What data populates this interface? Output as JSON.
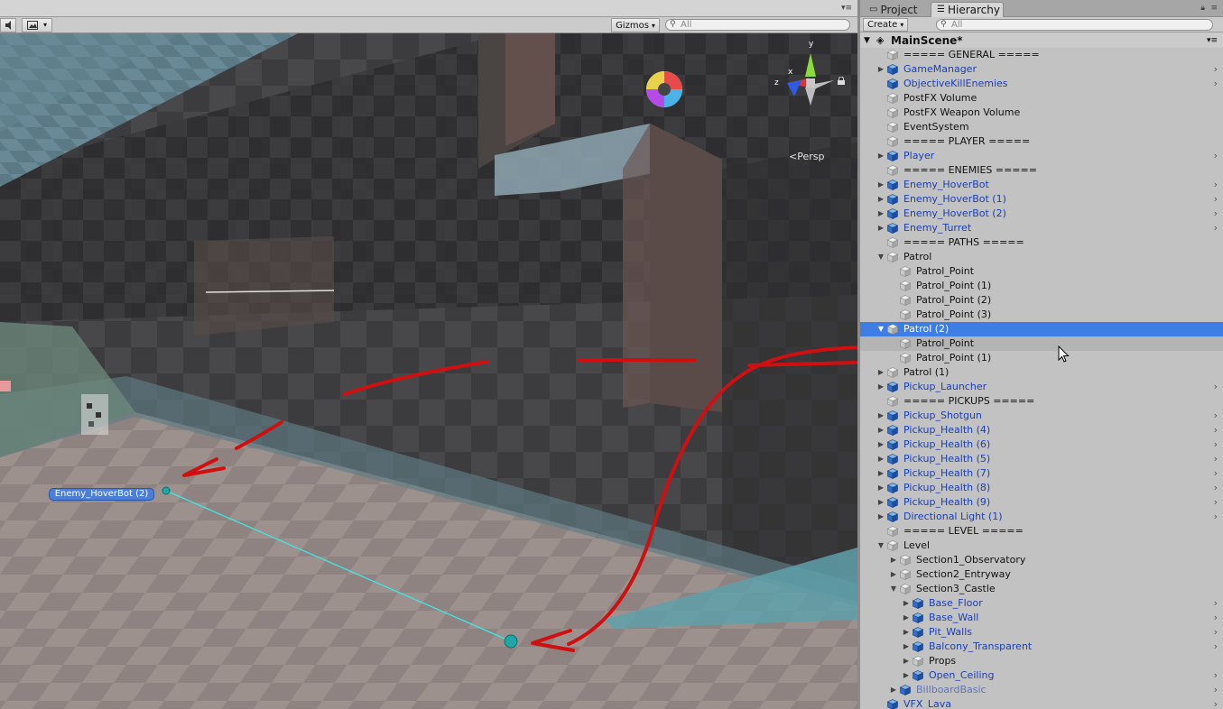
{
  "scene": {
    "gizmos_label": "Gizmos",
    "search_placeholder": "All",
    "persp_label": "<Persp",
    "axis_y": "y",
    "axis_x": "x",
    "axis_z": "z",
    "hoverbot_label": "Enemy_HoverBot (2)"
  },
  "hierarchy": {
    "tab_project": "Project",
    "tab_hierarchy": "Hierarchy",
    "create_label": "Create",
    "search_placeholder": "All",
    "scene_name": "MainScene*",
    "rows": [
      {
        "label": "===== GENERAL =====",
        "indent": 0,
        "arrow": "",
        "icon": "gray",
        "style": "normal",
        "chevron": false
      },
      {
        "label": "GameManager",
        "indent": 0,
        "arrow": "collapsed",
        "icon": "blue",
        "style": "prefab",
        "chevron": true
      },
      {
        "label": "ObjectiveKillEnemies",
        "indent": 0,
        "arrow": "",
        "icon": "blue",
        "style": "prefab",
        "chevron": true
      },
      {
        "label": "PostFX Volume",
        "indent": 0,
        "arrow": "",
        "icon": "gray",
        "style": "normal",
        "chevron": false
      },
      {
        "label": "PostFX Weapon Volume",
        "indent": 0,
        "arrow": "",
        "icon": "gray",
        "style": "normal",
        "chevron": false
      },
      {
        "label": "EventSystem",
        "indent": 0,
        "arrow": "",
        "icon": "gray",
        "style": "normal",
        "chevron": false
      },
      {
        "label": "===== PLAYER =====",
        "indent": 0,
        "arrow": "",
        "icon": "gray",
        "style": "normal",
        "chevron": false
      },
      {
        "label": "Player",
        "indent": 0,
        "arrow": "collapsed",
        "icon": "blue",
        "style": "prefab",
        "chevron": true
      },
      {
        "label": "===== ENEMIES =====",
        "indent": 0,
        "arrow": "",
        "icon": "gray",
        "style": "normal",
        "chevron": false
      },
      {
        "label": "Enemy_HoverBot",
        "indent": 0,
        "arrow": "collapsed",
        "icon": "blue",
        "style": "prefab",
        "chevron": true
      },
      {
        "label": "Enemy_HoverBot (1)",
        "indent": 0,
        "arrow": "collapsed",
        "icon": "blue",
        "style": "prefab",
        "chevron": true
      },
      {
        "label": "Enemy_HoverBot (2)",
        "indent": 0,
        "arrow": "collapsed",
        "icon": "blue",
        "style": "prefab",
        "chevron": true
      },
      {
        "label": "Enemy_Turret",
        "indent": 0,
        "arrow": "collapsed",
        "icon": "blue",
        "style": "prefab",
        "chevron": true
      },
      {
        "label": "===== PATHS =====",
        "indent": 0,
        "arrow": "",
        "icon": "gray",
        "style": "normal",
        "chevron": false
      },
      {
        "label": "Patrol",
        "indent": 0,
        "arrow": "expanded",
        "icon": "gray",
        "style": "normal",
        "chevron": false
      },
      {
        "label": "Patrol_Point",
        "indent": 1,
        "arrow": "",
        "icon": "gray",
        "style": "normal",
        "chevron": false
      },
      {
        "label": "Patrol_Point (1)",
        "indent": 1,
        "arrow": "",
        "icon": "gray",
        "style": "normal",
        "chevron": false
      },
      {
        "label": "Patrol_Point (2)",
        "indent": 1,
        "arrow": "",
        "icon": "gray",
        "style": "normal",
        "chevron": false
      },
      {
        "label": "Patrol_Point (3)",
        "indent": 1,
        "arrow": "",
        "icon": "gray",
        "style": "normal",
        "chevron": false
      },
      {
        "label": "Patrol (2)",
        "indent": 0,
        "arrow": "expanded",
        "icon": "gray",
        "style": "selected",
        "chevron": false
      },
      {
        "label": "Patrol_Point",
        "indent": 1,
        "arrow": "",
        "icon": "gray",
        "style": "hover",
        "chevron": false
      },
      {
        "label": "Patrol_Point (1)",
        "indent": 1,
        "arrow": "",
        "icon": "gray",
        "style": "normal",
        "chevron": false
      },
      {
        "label": "Patrol (1)",
        "indent": 0,
        "arrow": "collapsed",
        "icon": "gray",
        "style": "normal",
        "chevron": false
      },
      {
        "label": "Pickup_Launcher",
        "indent": 0,
        "arrow": "collapsed",
        "icon": "blue",
        "style": "prefab",
        "chevron": true
      },
      {
        "label": "===== PICKUPS =====",
        "indent": 0,
        "arrow": "",
        "icon": "gray",
        "style": "normal",
        "chevron": false
      },
      {
        "label": "Pickup_Shotgun",
        "indent": 0,
        "arrow": "collapsed",
        "icon": "blue",
        "style": "prefab",
        "chevron": true
      },
      {
        "label": "Pickup_Health (4)",
        "indent": 0,
        "arrow": "collapsed",
        "icon": "blue",
        "style": "prefab",
        "chevron": true
      },
      {
        "label": "Pickup_Health (6)",
        "indent": 0,
        "arrow": "collapsed",
        "icon": "blue",
        "style": "prefab",
        "chevron": true
      },
      {
        "label": "Pickup_Health (5)",
        "indent": 0,
        "arrow": "collapsed",
        "icon": "blue",
        "style": "prefab",
        "chevron": true
      },
      {
        "label": "Pickup_Health (7)",
        "indent": 0,
        "arrow": "collapsed",
        "icon": "blue",
        "style": "prefab",
        "chevron": true
      },
      {
        "label": "Pickup_Health (8)",
        "indent": 0,
        "arrow": "collapsed",
        "icon": "blue",
        "style": "prefab",
        "chevron": true
      },
      {
        "label": "Pickup_Health (9)",
        "indent": 0,
        "arrow": "collapsed",
        "icon": "blue",
        "style": "prefab",
        "chevron": true
      },
      {
        "label": "Directional Light (1)",
        "indent": 0,
        "arrow": "collapsed",
        "icon": "blue",
        "style": "prefab",
        "chevron": true
      },
      {
        "label": "===== LEVEL =====",
        "indent": 0,
        "arrow": "",
        "icon": "gray",
        "style": "normal",
        "chevron": false
      },
      {
        "label": "Level",
        "indent": 0,
        "arrow": "expanded",
        "icon": "gray",
        "style": "normal",
        "chevron": false
      },
      {
        "label": "Section1_Observatory",
        "indent": 1,
        "arrow": "collapsed",
        "icon": "gray",
        "style": "normal",
        "chevron": false
      },
      {
        "label": "Section2_Entryway",
        "indent": 1,
        "arrow": "collapsed",
        "icon": "gray",
        "style": "normal",
        "chevron": false
      },
      {
        "label": "Section3_Castle",
        "indent": 1,
        "arrow": "expanded",
        "icon": "gray",
        "style": "normal",
        "chevron": false
      },
      {
        "label": "Base_Floor",
        "indent": 2,
        "arrow": "collapsed",
        "icon": "blue",
        "style": "prefab",
        "chevron": true
      },
      {
        "label": "Base_Wall",
        "indent": 2,
        "arrow": "collapsed",
        "icon": "blue",
        "style": "prefab",
        "chevron": true
      },
      {
        "label": "Pit_Walls",
        "indent": 2,
        "arrow": "collapsed",
        "icon": "blue",
        "style": "prefab",
        "chevron": true
      },
      {
        "label": "Balcony_Transparent",
        "indent": 2,
        "arrow": "collapsed",
        "icon": "blue",
        "style": "prefab",
        "chevron": true
      },
      {
        "label": "Props",
        "indent": 2,
        "arrow": "collapsed",
        "icon": "gray",
        "style": "normal",
        "chevron": false
      },
      {
        "label": "Open_Ceiling",
        "indent": 2,
        "arrow": "collapsed",
        "icon": "blue",
        "style": "prefab",
        "chevron": true
      },
      {
        "label": "BillboardBasic",
        "indent": 1,
        "arrow": "collapsed",
        "icon": "blue",
        "style": "faded",
        "chevron": true
      },
      {
        "label": "VFX_Lava",
        "indent": 0,
        "arrow": "",
        "icon": "blue",
        "style": "prefab",
        "chevron": true
      }
    ]
  },
  "colors": {
    "selection": "#3e7de3",
    "prefab_text": "#1a3fb0",
    "annotation_red": "#d01010",
    "patrol_line": "#3ee8e8"
  }
}
